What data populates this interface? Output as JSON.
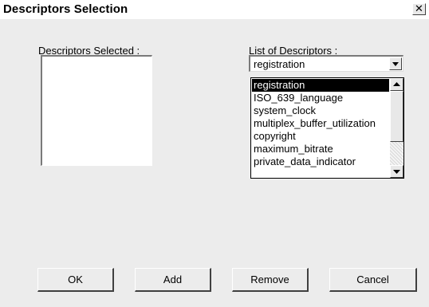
{
  "window": {
    "title": "Descriptors Selection",
    "close_glyph": "✕"
  },
  "left_panel": {
    "label": "Descriptors Selected :",
    "items": []
  },
  "right_panel": {
    "label": "List of Descriptors :",
    "combo_value": "registration",
    "options": [
      "registration",
      "ISO_639_language",
      "system_clock",
      "multiplex_buffer_utilization",
      "copyright",
      "maximum_bitrate",
      "private_data_indicator"
    ],
    "selected_index": 0
  },
  "buttons": {
    "ok": "OK",
    "add": "Add",
    "remove": "Remove",
    "cancel": "Cancel"
  },
  "icons": {
    "close": "close-icon",
    "combo_arrow": "chevron-down-icon",
    "scroll_up": "chevron-up-icon",
    "scroll_down": "chevron-down-icon"
  },
  "colors": {
    "background": "#ececec",
    "selection": "#000000",
    "selection_text": "#ffffff"
  }
}
